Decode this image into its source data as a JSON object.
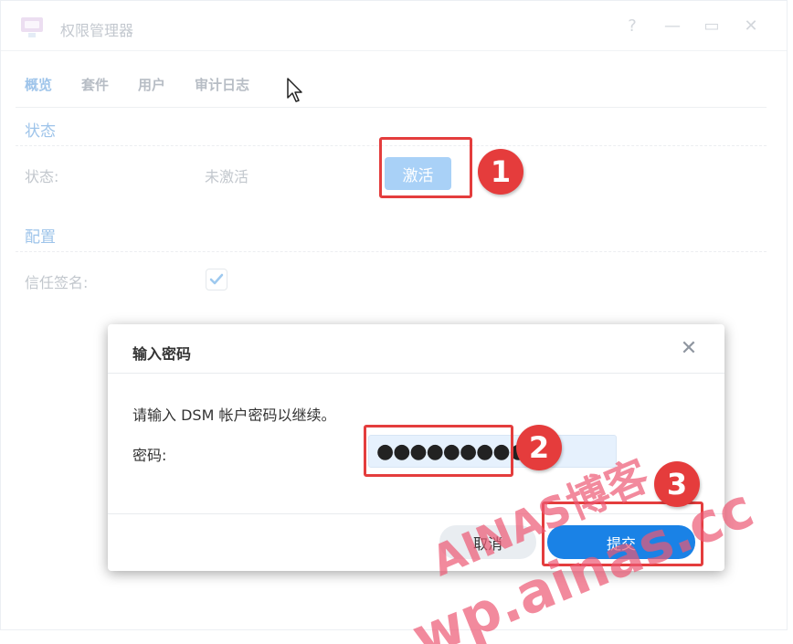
{
  "window": {
    "title": "权限管理器",
    "controls": {
      "help": "?",
      "minimize": "—",
      "maximize": "▭",
      "close": "✕"
    }
  },
  "tabs": [
    {
      "label": "概览",
      "active": true
    },
    {
      "label": "套件",
      "active": false
    },
    {
      "label": "用户",
      "active": false
    },
    {
      "label": "审计日志",
      "active": false
    }
  ],
  "status_section": {
    "title": "状态",
    "label": "状态:",
    "value": "未激活",
    "activate_button": "激活"
  },
  "config_section": {
    "title": "配置",
    "trust_label": "信任签名:",
    "trust_checked": true
  },
  "dialog": {
    "title": "输入密码",
    "close": "✕",
    "prompt": "请输入 DSM 帐户密码以继续。",
    "password_label": "密码:",
    "password_value": "●●●●●●●●●●●",
    "cancel_button": "取消",
    "submit_button": "提交"
  },
  "annotations": {
    "step1": "1",
    "step2": "2",
    "step3": "3"
  },
  "watermark": {
    "line1": "AINAS博客",
    "line2": "wp.ainas.cc"
  },
  "colors": {
    "accent": "#1a82e6",
    "annotation_red": "#e53c3c",
    "section_title": "#9ec4ea"
  }
}
